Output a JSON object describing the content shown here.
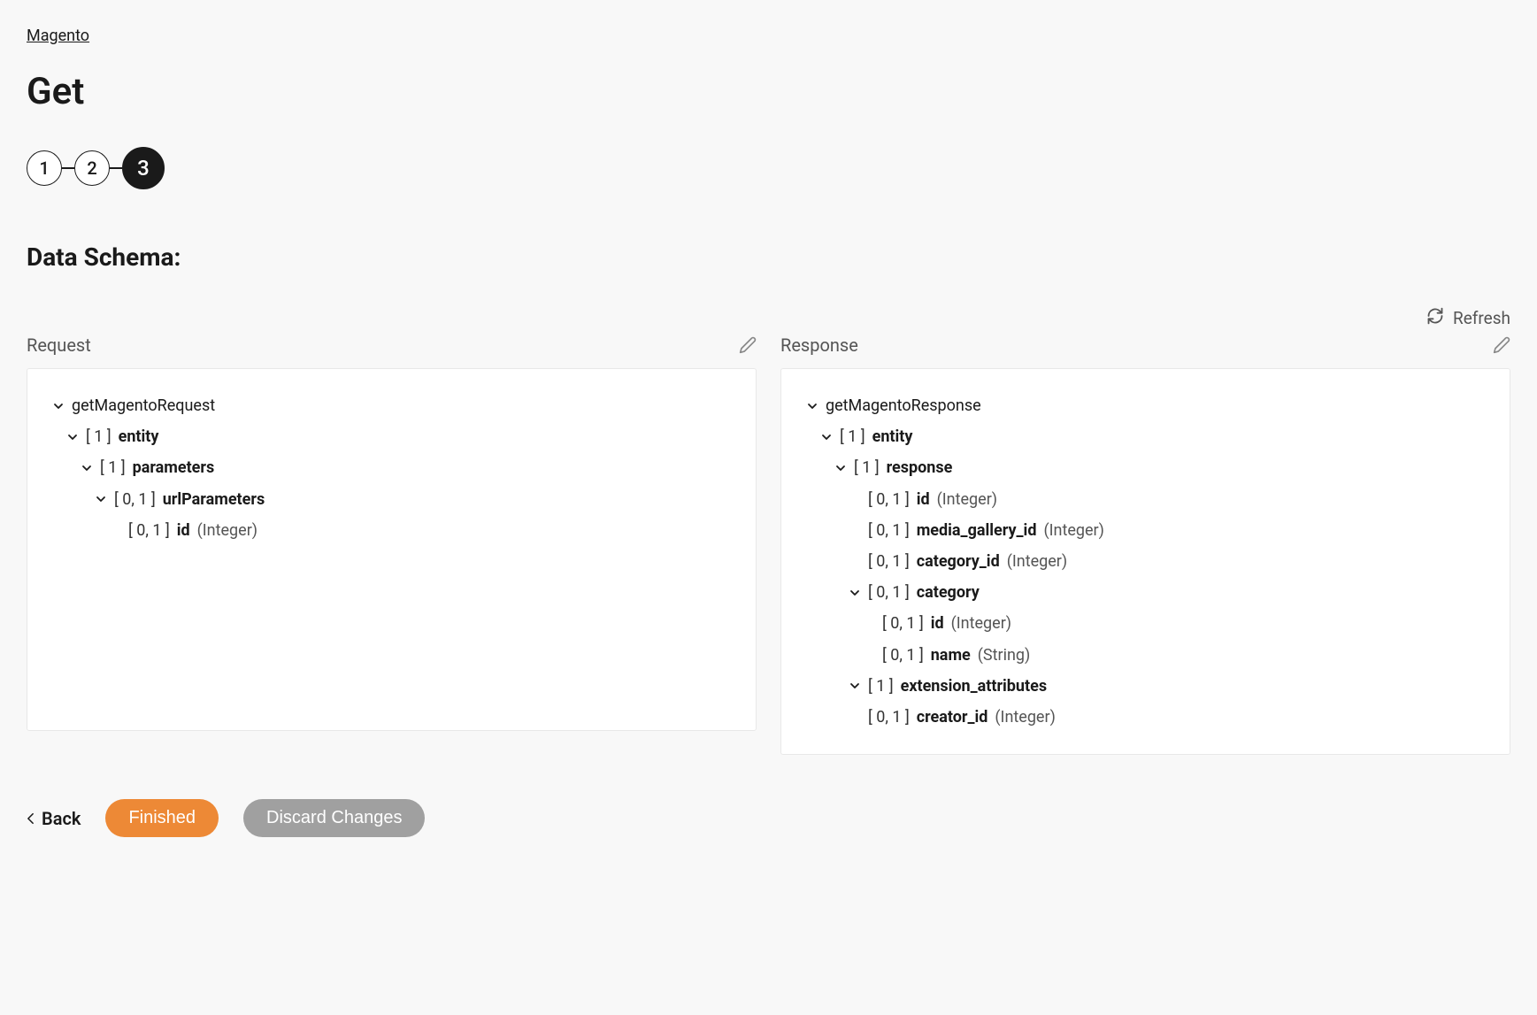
{
  "breadcrumb": {
    "label": "Magento"
  },
  "page_title": "Get",
  "stepper": {
    "steps": [
      "1",
      "2",
      "3"
    ],
    "active_index": 2
  },
  "section_title": "Data Schema:",
  "refresh_label": "Refresh",
  "request": {
    "label": "Request",
    "tree": [
      {
        "indent": 0,
        "chevron": true,
        "card": "",
        "name": "getMagentoRequest",
        "type": "",
        "bold": false
      },
      {
        "indent": 1,
        "chevron": true,
        "card": "[ 1 ]",
        "name": "entity",
        "type": "",
        "bold": true
      },
      {
        "indent": 2,
        "chevron": true,
        "card": "[ 1 ]",
        "name": "parameters",
        "type": "",
        "bold": true
      },
      {
        "indent": 3,
        "chevron": true,
        "card": "[ 0, 1 ]",
        "name": "urlParameters",
        "type": "",
        "bold": true
      },
      {
        "indent": 4,
        "chevron": false,
        "card": "[ 0, 1 ]",
        "name": "id",
        "type": "(Integer)",
        "bold": true
      }
    ]
  },
  "response": {
    "label": "Response",
    "tree": [
      {
        "indent": 0,
        "chevron": true,
        "card": "",
        "name": "getMagentoResponse",
        "type": "",
        "bold": false
      },
      {
        "indent": 1,
        "chevron": true,
        "card": "[ 1 ]",
        "name": "entity",
        "type": "",
        "bold": true
      },
      {
        "indent": 2,
        "chevron": true,
        "card": "[ 1 ]",
        "name": "response",
        "type": "",
        "bold": true
      },
      {
        "indent": 3,
        "chevron": false,
        "card": "[ 0, 1 ]",
        "name": "id",
        "type": "(Integer)",
        "bold": true
      },
      {
        "indent": 3,
        "chevron": false,
        "card": "[ 0, 1 ]",
        "name": "media_gallery_id",
        "type": "(Integer)",
        "bold": true
      },
      {
        "indent": 3,
        "chevron": false,
        "card": "[ 0, 1 ]",
        "name": "category_id",
        "type": "(Integer)",
        "bold": true
      },
      {
        "indent": 3,
        "chevron": true,
        "card": "[ 0, 1 ]",
        "name": "category",
        "type": "",
        "bold": true
      },
      {
        "indent": 4,
        "chevron": false,
        "card": "[ 0, 1 ]",
        "name": "id",
        "type": "(Integer)",
        "bold": true
      },
      {
        "indent": 4,
        "chevron": false,
        "card": "[ 0, 1 ]",
        "name": "name",
        "type": "(String)",
        "bold": true
      },
      {
        "indent": 3,
        "chevron": true,
        "card": "[ 1 ]",
        "name": "extension_attributes",
        "type": "",
        "bold": true
      },
      {
        "indent": 3,
        "chevron": false,
        "card": "[ 0, 1 ]",
        "name": "creator_id",
        "type": "(Integer)",
        "bold": true
      }
    ]
  },
  "footer": {
    "back": "Back",
    "finished": "Finished",
    "discard": "Discard Changes"
  }
}
